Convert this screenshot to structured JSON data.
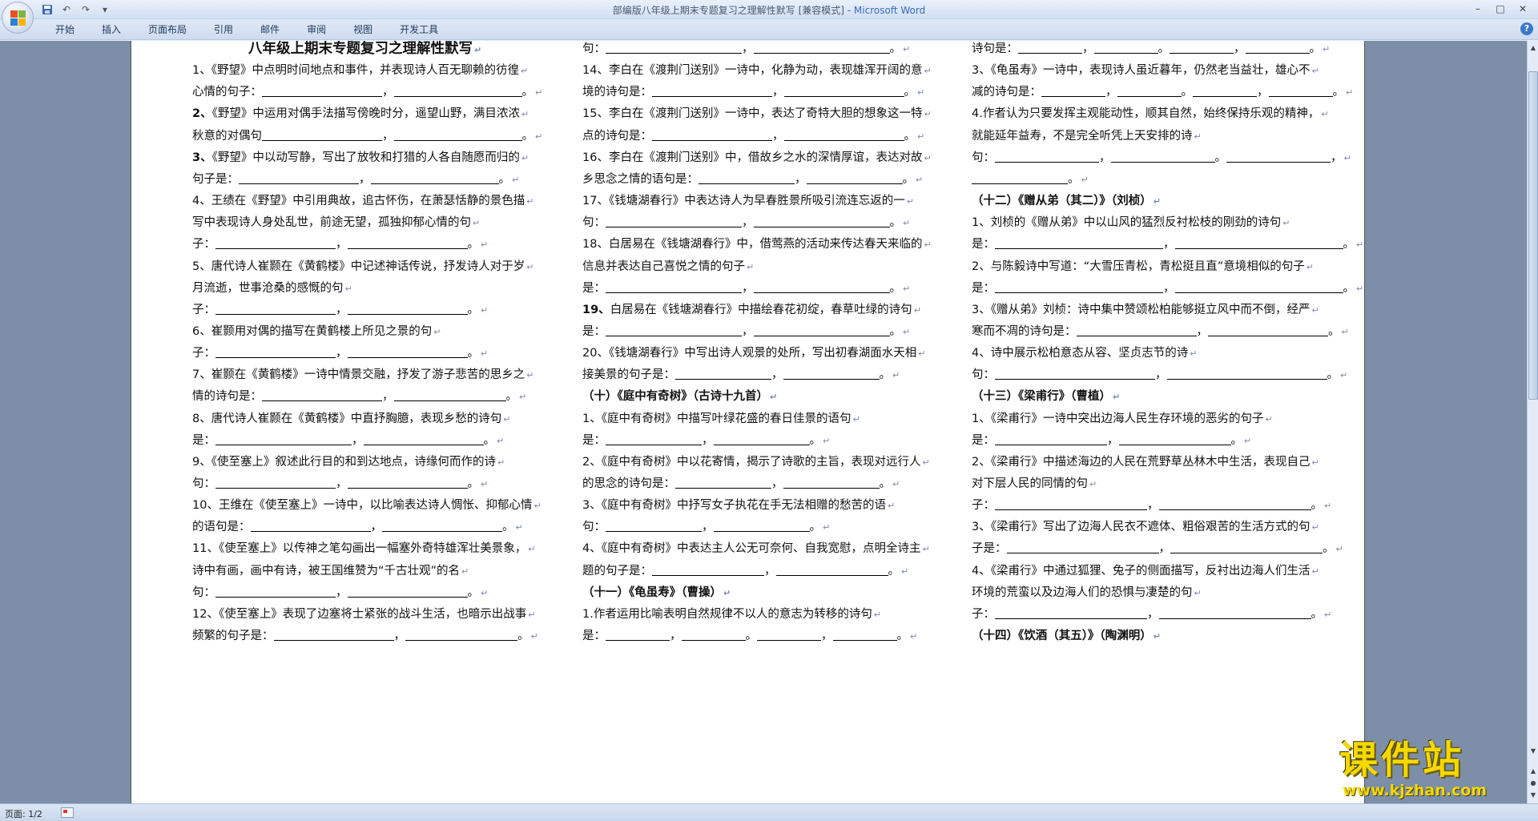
{
  "window": {
    "title": "部编版八年级上期末专题复习之理解性默写 [兼容模式] - ",
    "app_name": "Microsoft Word"
  },
  "quick_access": {
    "save_icon": "save-icon",
    "undo_icon": "undo-icon",
    "redo_icon": "redo-icon",
    "customize_icon": "customize-icon"
  },
  "ribbon": {
    "tabs": [
      "开始",
      "插入",
      "页面布局",
      "引用",
      "邮件",
      "审阅",
      "视图",
      "开发工具"
    ]
  },
  "status_bar": {
    "page": "页面: 1/2"
  },
  "watermark": {
    "cn": "课件站",
    "url": "www.kjzhan.com"
  },
  "colors": {
    "watermark": "#f4d800",
    "doc_background": "#7c8ea8",
    "ribbon": "#dfe8f5"
  },
  "document": {
    "columns": [
      {
        "lines": [
          {
            "t": "八年级上期末专题复习之理解性默写",
            "style": "title"
          },
          {
            "t": "1、《野望》中点明时间地点和事件，并表现诗人百无聊赖的彷徨"
          },
          {
            "t": "心情的句子：",
            "blanks": [
              150,
              160
            ],
            "seps": [
              "，",
              "。"
            ]
          },
          {
            "t": "2、《野望》中运用对偶手法描写傍晚时分，遥望山野，满目浓浓",
            "bold_num": true
          },
          {
            "t": "秋意的对偶句",
            "blanks": [
              150,
              160
            ],
            "seps": [
              "，",
              "。"
            ]
          },
          {
            "t": "3、《野望》中以动写静，写出了放牧和打猎的人各自随愿而归的",
            "bold_num": true
          },
          {
            "t": "句子是：",
            "blanks": [
              150,
              160
            ],
            "seps": [
              "，",
              "。"
            ]
          },
          {
            "t": "4、王绩在《野望》中引用典故，追古怀伤，在萧瑟恬静的景色描"
          },
          {
            "t": "写中表现诗人身处乱世，前途无望，孤独抑郁心情的句"
          },
          {
            "t": "子：",
            "blanks": [
              150,
              150
            ],
            "seps": [
              "，",
              "。"
            ]
          },
          {
            "t": "5、唐代诗人崔颢在《黄鹤楼》中记述神话传说，抒发诗人对于岁"
          },
          {
            "t": "月流逝，世事沧桑的感慨的句"
          },
          {
            "t": "子：",
            "blanks": [
              150,
              150
            ],
            "seps": [
              "，",
              "。"
            ]
          },
          {
            "t": "6、崔颢用对偶的描写在黄鹤楼上所见之景的句"
          },
          {
            "t": "子：",
            "blanks": [
              150,
              150
            ],
            "seps": [
              "，",
              "。"
            ]
          },
          {
            "t": "7、崔颢在《黄鹤楼》一诗中情景交融，抒发了游子悲苦的思乡之"
          },
          {
            "t": "情的诗句是：",
            "blanks": [
              150,
              140
            ],
            "seps": [
              "，",
              "。"
            ]
          },
          {
            "t": "8、唐代诗人崔颢在《黄鹤楼》中直抒胸臆，表现乡愁的诗句"
          },
          {
            "t": "是：",
            "blanks": [
              170,
              150
            ],
            "seps": [
              "，",
              "。"
            ]
          },
          {
            "t": "9、《使至塞上》叙述此行目的和到达地点，诗缘何而作的诗"
          },
          {
            "t": "句：",
            "blanks": [
              150,
              150
            ],
            "seps": [
              "，",
              "。"
            ]
          },
          {
            "t": "10、王维在《使至塞上》一诗中，以比喻表达诗人惆怅、抑郁心情"
          },
          {
            "t": "的语句是：",
            "blanks": [
              150,
              150
            ],
            "seps": [
              "，",
              "。"
            ]
          },
          {
            "t": "11、《使至塞上》以传神之笔勾画出一幅塞外奇特雄浑壮美景象，"
          },
          {
            "t": "诗中有画，画中有诗，被王国维赞为“千古壮观”的名"
          },
          {
            "t": "句：",
            "blanks": [
              150,
              150
            ],
            "seps": [
              "，",
              "。"
            ]
          },
          {
            "t": "12、《使至塞上》表现了边塞将士紧张的战斗生活，也暗示出战事"
          },
          {
            "t": "频繁的句子是：",
            "blanks": [
              150,
              140
            ],
            "seps": [
              "，",
              "。"
            ]
          }
        ]
      },
      {
        "lines": [
          {
            "t": "句：",
            "blanks": [
              170,
              170
            ],
            "seps": [
              "，",
              "。"
            ]
          },
          {
            "t": "14、李白在《渡荆门送别》一诗中，化静为动，表现雄浑开阔的意"
          },
          {
            "t": "境的诗句是：",
            "blanks": [
              150,
              150
            ],
            "seps": [
              "，",
              "。"
            ]
          },
          {
            "t": "15、李白在《渡荆门送别》一诗中，表达了奇特大胆的想象这一特"
          },
          {
            "t": "点的诗句是：",
            "blanks": [
              150,
              150
            ],
            "seps": [
              "，",
              "。"
            ]
          },
          {
            "t": "16、李白在《渡荆门送别》中，借故乡之水的深情厚谊，表达对故"
          },
          {
            "t": "乡思念之情的语句是：",
            "blanks": [
              120,
              120
            ],
            "seps": [
              "，",
              "。"
            ]
          },
          {
            "t": "17、《钱塘湖春行》中表达诗人为早春胜景所吸引流连忘返的一"
          },
          {
            "t": "句：",
            "blanks": [
              170,
              170
            ],
            "seps": [
              "，",
              "。"
            ]
          },
          {
            "t": "18、白居易在《钱塘湖春行》中，借莺燕的活动来传达春天来临的"
          },
          {
            "t": "信息并表达自己喜悦之情的句子"
          },
          {
            "t": "是：",
            "blanks": [
              170,
              170
            ],
            "seps": [
              "，",
              "。"
            ]
          },
          {
            "t": "19、白居易在《钱塘湖春行》中描绘春花初绽，春草吐绿的诗句",
            "bold_num": true
          },
          {
            "t": "是：",
            "blanks": [
              170,
              170
            ],
            "seps": [
              "，",
              "。"
            ]
          },
          {
            "t": "20、《钱塘湖春行》中写出诗人观景的处所，写出初春湖面水天相"
          },
          {
            "t": "接美景的句子是：",
            "blanks": [
              120,
              120
            ],
            "seps": [
              "，",
              "。"
            ]
          },
          {
            "t": "（十）《庭中有奇树》（古诗十九首）",
            "style": "head"
          },
          {
            "t": "1、《庭中有奇树》中描写叶绿花盛的春日佳景的语句"
          },
          {
            "t": "是：",
            "blanks": [
              120,
              120
            ],
            "seps": [
              "，",
              "。"
            ]
          },
          {
            "t": "2、《庭中有奇树》中以花寄情，揭示了诗歌的主旨，表现对远行人"
          },
          {
            "t": "的思念的诗句是：",
            "blanks": [
              120,
              120
            ],
            "seps": [
              "，",
              "。"
            ]
          },
          {
            "t": "3、《庭中有奇树》中抒写女子执花在手无法相赠的愁苦的语"
          },
          {
            "t": "句：",
            "blanks": [
              120,
              120
            ],
            "seps": [
              "，",
              "。"
            ]
          },
          {
            "t": "4、《庭中有奇树》中表达主人公无可奈何、自我宽慰，点明全诗主"
          },
          {
            "t": "题的句子是：",
            "blanks": [
              140,
              140
            ],
            "seps": [
              "，",
              "。"
            ]
          },
          {
            "t": "（十一）《龟虽寿》（曹操）",
            "style": "head"
          },
          {
            "t": "1.作者运用比喻表明自然规律不以人的意志为转移的诗句"
          },
          {
            "t": "是：",
            "blanks": [
              80,
              80,
              80,
              80
            ],
            "seps": [
              "，",
              "。",
              "，",
              "。"
            ]
          }
        ]
      },
      {
        "lines": [
          {
            "t": "诗句是：",
            "blanks": [
              80,
              80,
              80,
              80
            ],
            "seps": [
              "，",
              "。",
              "，",
              "。"
            ]
          },
          {
            "t": "3、《龟虽寿》一诗中，表现诗人虽近暮年，仍然老当益壮，雄心不"
          },
          {
            "t": "减的诗句是：",
            "blanks": [
              80,
              80,
              80,
              80
            ],
            "seps": [
              "，",
              "。",
              "，",
              "。"
            ]
          },
          {
            "t": "4.作者认为只要发挥主观能动性，顺其自然，始终保持乐观的精神，"
          },
          {
            "t": "就能延年益寿，不是完全听凭上天安排的诗"
          },
          {
            "t": "句：",
            "blanks": [
              130,
              130,
              130
            ],
            "seps": [
              "，",
              "。",
              "，"
            ]
          },
          {
            "t": "",
            "blanks": [
              120
            ],
            "seps": [
              "。"
            ]
          },
          {
            "t": "（十二）《赠从弟（其二）》（刘桢）",
            "style": "head"
          },
          {
            "t": "1、刘桢的《赠从弟》中以山风的猛烈反衬松枝的刚劲的诗句"
          },
          {
            "t": "是：",
            "blanks": [
              210,
              210
            ],
            "seps": [
              "，",
              "。"
            ]
          },
          {
            "t": "2、与陈毅诗中写道：“大雪压青松，青松挺且直”意境相似的句子"
          },
          {
            "t": "是：",
            "blanks": [
              210,
              210
            ],
            "seps": [
              "，",
              "。"
            ]
          },
          {
            "t": "3、《赠从弟》刘桢：诗中集中赞颂松柏能够挺立风中而不倒，经严"
          },
          {
            "t": "寒而不凋的诗句是：",
            "blanks": [
              150,
              150
            ],
            "seps": [
              "，",
              "。"
            ]
          },
          {
            "t": "4、诗中展示松柏意态从容、坚贞志节的诗"
          },
          {
            "t": "句：",
            "blanks": [
              200,
              200
            ],
            "seps": [
              "，",
              "。"
            ]
          },
          {
            "t": "（十三）《梁甫行》（曹植）",
            "style": "head"
          },
          {
            "t": "1、《梁甫行》一诗中突出边海人民生存环境的恶劣的句子"
          },
          {
            "t": "是：",
            "blanks": [
              140,
              140
            ],
            "seps": [
              "，",
              "。"
            ]
          },
          {
            "t": "2、《梁甫行》中描述海边的人民在荒野草丛林木中生活，表现自己"
          },
          {
            "t": "对下层人民的同情的句"
          },
          {
            "t": "子：",
            "blanks": [
              190,
              190
            ],
            "seps": [
              "，",
              "。"
            ]
          },
          {
            "t": "3、《梁甫行》写出了边海人民衣不遮体、粗俗艰苦的生活方式的句"
          },
          {
            "t": "子是：",
            "blanks": [
              190,
              190
            ],
            "seps": [
              "，",
              "。"
            ]
          },
          {
            "t": "4、《梁甫行》中通过狐狸、兔子的侧面描写，反衬出边海人们生活"
          },
          {
            "t": "环境的荒蛮以及边海人们的恐惧与凄楚的句"
          },
          {
            "t": "子：",
            "blanks": [
              190,
              190
            ],
            "seps": [
              "，",
              "。"
            ]
          },
          {
            "t": "（十四）《饮酒（其五）》（陶渊明）",
            "style": "head"
          }
        ]
      }
    ]
  }
}
